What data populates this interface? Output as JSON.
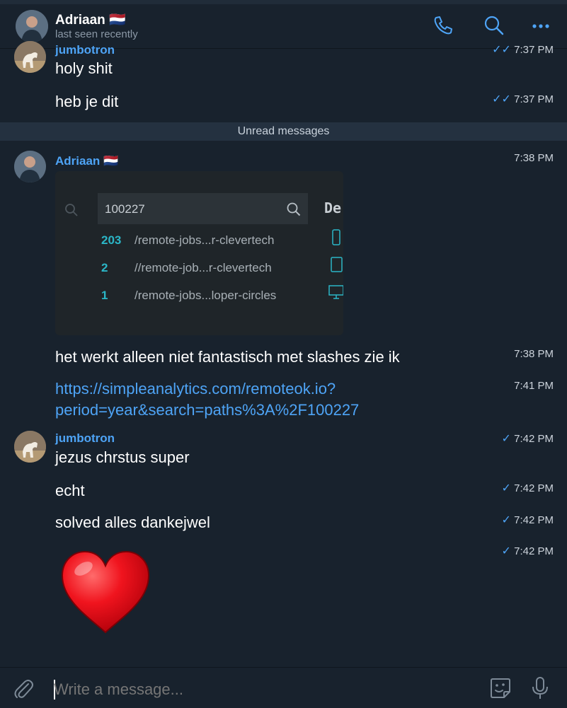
{
  "header": {
    "contact_name": "Adriaan 🇳🇱",
    "status": "last seen recently",
    "icons": [
      "phone-icon",
      "search-icon",
      "more-icon"
    ]
  },
  "messages": {
    "m1": {
      "sender": "jumbotron",
      "text": "holy shit",
      "time": "7:37 PM",
      "status": "read"
    },
    "m2": {
      "text": "heb je dit",
      "time": "7:37 PM",
      "status": "read"
    },
    "unread_divider": "Unread messages",
    "m3": {
      "sender": "Adriaan 🇳🇱",
      "time": "7:38 PM",
      "image": {
        "query": "100227",
        "column_header": "De",
        "rows": [
          {
            "count": "203",
            "path": "/remote-jobs...r-clevertech",
            "device": "phone"
          },
          {
            "count": "2",
            "path": "//remote-job...r-clevertech",
            "device": "tablet"
          },
          {
            "count": "1",
            "path": "/remote-jobs...loper-circles",
            "device": "desktop"
          }
        ]
      }
    },
    "m4": {
      "text": "het werkt alleen niet fantastisch met slashes zie ik",
      "time": "7:38 PM"
    },
    "m5": {
      "link_line1": "https://simpleanalytics.com/remoteok.io?",
      "link_line2": "period=year&search=paths%3A%2F100227",
      "time": "7:41 PM"
    },
    "m6": {
      "sender": "jumbotron",
      "text": "jezus chrstus super",
      "time": "7:42 PM",
      "status": "sent"
    },
    "m7": {
      "text": "echt",
      "time": "7:42 PM",
      "status": "sent"
    },
    "m8": {
      "text": "solved alles dankejwel",
      "time": "7:42 PM",
      "status": "sent"
    },
    "m9": {
      "emoji": "heart",
      "time": "7:42 PM",
      "status": "sent"
    }
  },
  "composer": {
    "placeholder": "Write a message...",
    "icons": [
      "attach-icon",
      "sticker-icon",
      "microphone-icon"
    ]
  },
  "colors": {
    "background": "#18222d",
    "accent": "#4ea4f6",
    "unread_bar": "#243140",
    "heart": "#e8101c"
  }
}
